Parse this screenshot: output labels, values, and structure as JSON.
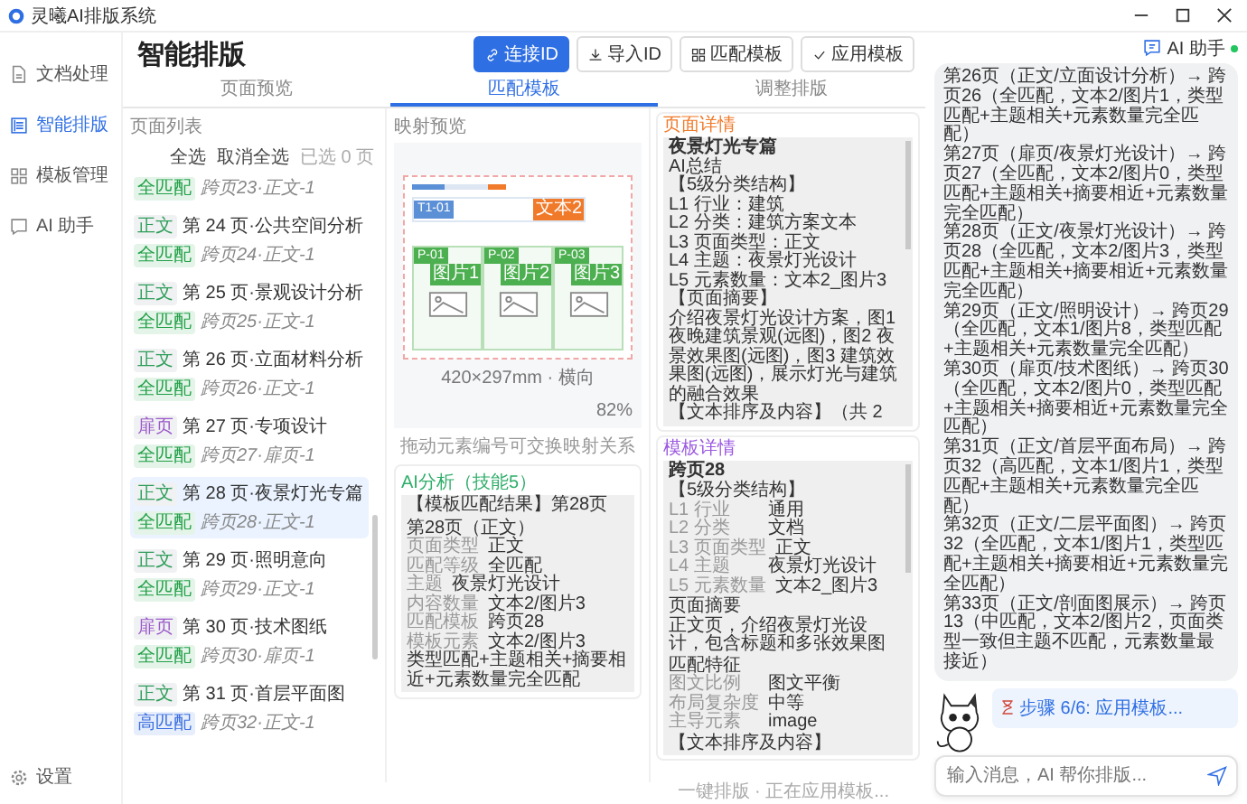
{
  "window": {
    "title": "灵曦AI排版系统"
  },
  "sidebar": {
    "items": [
      {
        "label": "文档处理",
        "selected": false
      },
      {
        "label": "智能排版",
        "selected": true
      },
      {
        "label": "模板管理",
        "selected": false
      },
      {
        "label": "AI 助手",
        "selected": false
      }
    ],
    "settings": "设置"
  },
  "header": {
    "title": "智能排版",
    "buttons": [
      {
        "label": "连接ID",
        "primary": true
      },
      {
        "label": "导入ID",
        "primary": false
      },
      {
        "label": "匹配模板",
        "primary": false
      },
      {
        "label": "应用模板",
        "primary": false
      }
    ]
  },
  "tabs": [
    {
      "label": "页面预览",
      "selected": false
    },
    {
      "label": "匹配模板",
      "selected": true
    },
    {
      "label": "调整排版",
      "selected": false
    }
  ],
  "page_list": {
    "title": "页面列表",
    "select_all": "全选",
    "deselect_all": "取消全选",
    "selected_count": "已选 0 页",
    "pages": [
      {
        "match": {
          "label": "全匹配",
          "color": "#22a047"
        },
        "mapping": "跨页23·正文-1",
        "selected": false
      },
      {
        "type": {
          "label": "正文",
          "color": "#2f9e5a"
        },
        "title": "第 24 页·公共空间分析",
        "match": {
          "label": "全匹配",
          "color": "#22a047"
        },
        "mapping": "跨页24·正文-1",
        "selected": false
      },
      {
        "type": {
          "label": "正文",
          "color": "#2f9e5a"
        },
        "title": "第 25 页·景观设计分析",
        "match": {
          "label": "全匹配",
          "color": "#22a047"
        },
        "mapping": "跨页25·正文-1",
        "selected": false
      },
      {
        "type": {
          "label": "正文",
          "color": "#2f9e5a"
        },
        "title": "第 26 页·立面材料分析",
        "match": {
          "label": "全匹配",
          "color": "#22a047"
        },
        "mapping": "跨页26·正文-1",
        "selected": false
      },
      {
        "type": {
          "label": "扉页",
          "color": "#9b59c9"
        },
        "title": "第 27 页·专项设计",
        "match": {
          "label": "全匹配",
          "color": "#22a047"
        },
        "mapping": "跨页27·扉页-1",
        "selected": false
      },
      {
        "type": {
          "label": "正文",
          "color": "#2f9e5a"
        },
        "title": "第 28 页·夜景灯光专篇",
        "match": {
          "label": "全匹配",
          "color": "#22a047"
        },
        "mapping": "跨页28·正文-1",
        "selected": true
      },
      {
        "type": {
          "label": "正文",
          "color": "#2f9e5a"
        },
        "title": "第 29 页·照明意向",
        "match": {
          "label": "全匹配",
          "color": "#22a047"
        },
        "mapping": "跨页29·正文-1",
        "selected": false
      },
      {
        "type": {
          "label": "扉页",
          "color": "#9b59c9"
        },
        "title": "第 30 页·技术图纸",
        "match": {
          "label": "全匹配",
          "color": "#22a047"
        },
        "mapping": "跨页30·扉页-1",
        "selected": false
      },
      {
        "type": {
          "label": "正文",
          "color": "#2f9e5a"
        },
        "title": "第 31 页·首层平面图",
        "match": {
          "label": "高匹配",
          "color": "#3b6fe0"
        },
        "mapping": "跨页32·正文-1",
        "selected": false
      }
    ]
  },
  "preview": {
    "title": "映射预览",
    "text_elements": [
      {
        "id": "T1-01",
        "tag": "文本2"
      }
    ],
    "image_elements": [
      {
        "id": "P-01",
        "tag": "图片1"
      },
      {
        "id": "P-02",
        "tag": "图片2"
      },
      {
        "id": "P-03",
        "tag": "图片3"
      }
    ],
    "size": "420×297mm · 横向",
    "zoom": "82%",
    "hint": "拖动元素编号可交换映射关系"
  },
  "analysis": {
    "title": "AI分析（技能5）",
    "heading": "【模板匹配结果】第28页",
    "subheading": "第28页（正文）",
    "rows": [
      {
        "key": "页面类型",
        "value": "正文"
      },
      {
        "key": "匹配等级",
        "value": "全匹配"
      },
      {
        "key": "主题",
        "value": "夜景灯光设计"
      },
      {
        "key": "内容数量",
        "value": "文本2/图片3"
      },
      {
        "key": "匹配模板",
        "value": "跨页28"
      },
      {
        "key": "模板元素",
        "value": "文本2/图片3"
      }
    ],
    "summary": "类型匹配+主题相关+摘要相近+元素数量完全匹配"
  },
  "details": [
    {
      "title": "页面详情",
      "color": "#f07a2a",
      "name": "夜景灯光专篇",
      "blocks": [
        {
          "kind": "text",
          "text": "AI总结"
        },
        {
          "kind": "text",
          "text": "【5级分类结构】"
        },
        {
          "kind": "text",
          "text": "L1 行业：建筑"
        },
        {
          "kind": "text",
          "text": "L2 分类：建筑方案文本"
        },
        {
          "kind": "text",
          "text": "L3 页面类型：正文"
        },
        {
          "kind": "text",
          "text": "L4 主题：夜景灯光设计"
        },
        {
          "kind": "text",
          "text": "L5 元素数量：文本2_图片3"
        },
        {
          "kind": "text",
          "text": "【页面摘要】"
        },
        {
          "kind": "text",
          "text": "介绍夜景灯光设计方案，图1 夜晚建筑景观(远图)，图2 夜景效果图(远图)，图3 建筑效果图(远图)，展示灯光与建筑的融合效果"
        },
        {
          "kind": "text",
          "text": "【文本排序及内容】（共 2"
        }
      ]
    },
    {
      "title": "模板详情",
      "color": "#9b59e0",
      "name": "跨页28",
      "blocks": [
        {
          "kind": "heading",
          "text": "【5级分类结构】"
        },
        {
          "kind": "kv",
          "key": "L1 行业",
          "value": "通用"
        },
        {
          "kind": "kv",
          "key": "L2 分类",
          "value": "文档"
        },
        {
          "kind": "kv",
          "key": "L3 页面类型",
          "value": "正文"
        },
        {
          "kind": "kv",
          "key": "L4 主题",
          "value": "夜景灯光设计"
        },
        {
          "kind": "kv",
          "key": "L5 元素数量",
          "value": "文本2_图片3"
        },
        {
          "kind": "heading",
          "text": "页面摘要"
        },
        {
          "kind": "text",
          "text": "正文页，介绍夜景灯光设计，包含标题和多张效果图"
        },
        {
          "kind": "heading",
          "text": "匹配特征"
        },
        {
          "kind": "kv",
          "key": "图文比例",
          "value": "图文平衡"
        },
        {
          "kind": "kv",
          "key": "布局复杂度",
          "value": "中等"
        },
        {
          "kind": "kv",
          "key": "主导元素",
          "value": "image"
        },
        {
          "kind": "heading",
          "text": "【文本排序及内容】"
        }
      ]
    }
  ],
  "footer": "一键排版 · 正在应用模板...",
  "chat": {
    "title": "AI 助手",
    "online": true,
    "messages": [
      "第26页（正文/立面设计分析）→ 跨页26（全匹配，文本2/图片1，类型匹配+主题相关+元素数量完全匹配）",
      "第27页（扉页/夜景灯光设计）→ 跨页27（全匹配，文本2/图片0，类型匹配+主题相关+摘要相近+元素数量完全匹配）",
      "第28页（正文/夜景灯光设计）→ 跨页28（全匹配，文本2/图片3，类型匹配+主题相关+摘要相近+元素数量完全匹配）",
      "第29页（正文/照明设计）→ 跨页29（全匹配，文本1/图片8，类型匹配+主题相关+元素数量完全匹配）",
      "第30页（扉页/技术图纸）→ 跨页30（全匹配，文本2/图片0，类型匹配+主题相关+摘要相近+元素数量完全匹配）",
      "第31页（正文/首层平面布局）→ 跨页32（高匹配，文本1/图片1，类型匹配+主题相关+元素数量完全匹配）",
      "第32页（正文/二层平面图）→ 跨页32（全匹配，文本1/图片1，类型匹配+主题相关+摘要相近+元素数量完全匹配）",
      "第33页（正文/剖面图展示）→ 跨页13（中匹配，文本2/图片2，页面类型一致但主题不匹配，元素数量最接近）"
    ],
    "progress": "步骤 6/6: 应用模板...",
    "input_placeholder": "输入消息，AI 帮你排版..."
  }
}
